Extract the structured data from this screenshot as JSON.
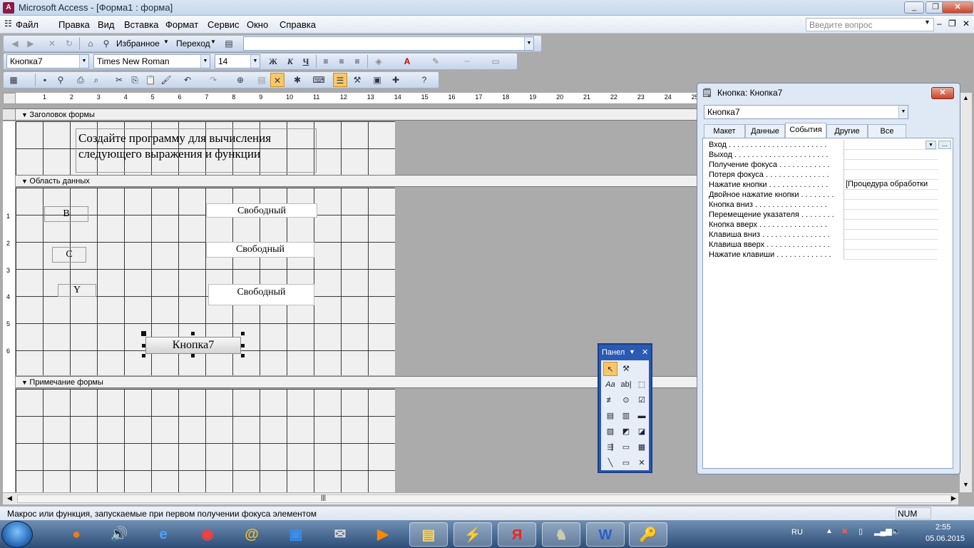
{
  "window": {
    "title": "Microsoft Access - [Форма1 : форма]",
    "buttons": [
      "_",
      "❐",
      "✕"
    ]
  },
  "menu": {
    "items": [
      "Файл",
      "Правка",
      "Вид",
      "Вставка",
      "Формат",
      "Сервис",
      "Окно",
      "Справка"
    ],
    "help_placeholder": "Введите вопрос"
  },
  "web_toolbar": {
    "favorites": "Избранное",
    "go": "Переход"
  },
  "format_toolbar": {
    "object": "Кнопка7",
    "font": "Times New Roman",
    "size": "14",
    "bold": "Ж",
    "italic": "К",
    "underline": "Ч"
  },
  "form": {
    "header_section": "Заголовок формы",
    "detail_section": "Область данных",
    "footer_section": "Примечание формы",
    "header_text_line1": "Создайте программу для вычисления",
    "header_text_line2": "следующего выражения и функции",
    "labels": [
      "B",
      "C",
      "Y"
    ],
    "textboxes": [
      "Свободный",
      "Свободный",
      "Свободный"
    ],
    "button": "Кнопка7"
  },
  "properties": {
    "title": "Кнопка: Кнопка7",
    "selected": "Кнопка7",
    "tabs": [
      "Макет",
      "Данные",
      "События",
      "Другие",
      "Все"
    ],
    "active_tab": "События",
    "rows": [
      {
        "name": "Вход . . . . . . . . . . . . . . . . . . . . . . .",
        "value": ""
      },
      {
        "name": "Выход . . . . . . . . . . . . . . . . . . . . . .",
        "value": ""
      },
      {
        "name": "Получение фокуса . . . . . . . . . . . .",
        "value": ""
      },
      {
        "name": "Потеря фокуса . . . . . . . . . . . . . . .",
        "value": ""
      },
      {
        "name": "Нажатие кнопки . . . . . . . . . . . . . .",
        "value": "[Процедура обработки"
      },
      {
        "name": "Двойное нажатие кнопки . . . . . . . .",
        "value": ""
      },
      {
        "name": "Кнопка вниз . . . . . . . . . . . . . . . . .",
        "value": ""
      },
      {
        "name": "Перемещение указателя . . . . . . . .",
        "value": ""
      },
      {
        "name": "Кнопка вверх . . . . . . . . . . . . . . . .",
        "value": ""
      },
      {
        "name": "Клавиша вниз . . . . . . . . . . . . . . . .",
        "value": ""
      },
      {
        "name": "Клавиша вверх . . . . . . . . . . . . . . .",
        "value": ""
      },
      {
        "name": "Нажатие клавиши . . . . . . . . . . . . .",
        "value": ""
      }
    ]
  },
  "toolbox": {
    "title": "Панел"
  },
  "status": {
    "text": "Макрос или функция, запускаемые при первом получении фокуса элементом",
    "num": "NUM"
  },
  "ruler": {
    "numbers": [
      "1",
      "2",
      "3",
      "4",
      "5",
      "6",
      "7",
      "8",
      "9",
      "10",
      "11",
      "12",
      "13",
      "14",
      "15",
      "16",
      "17",
      "18",
      "19",
      "20",
      "21",
      "22",
      "23",
      "24",
      "25"
    ],
    "vnumbers": [
      "1",
      "2",
      "3",
      "4",
      "5",
      "6"
    ]
  },
  "taskbar": {
    "lang": "RU",
    "time": "2:55",
    "date": "05.06.2015",
    "apps": [
      "firefox-icon",
      "speaker-icon",
      "ie-icon",
      "chrome-icon",
      "mail-at-icon",
      "maxthon-icon",
      "email-icon",
      "media-icon",
      "explorer-icon",
      "tool-icon",
      "yandex-icon",
      "game-icon",
      "word-icon",
      "access-icon"
    ]
  },
  "colors": {
    "accent": "#2a5ab4",
    "grid_bg": "#f0f0f0",
    "workspace": "#ababab"
  }
}
